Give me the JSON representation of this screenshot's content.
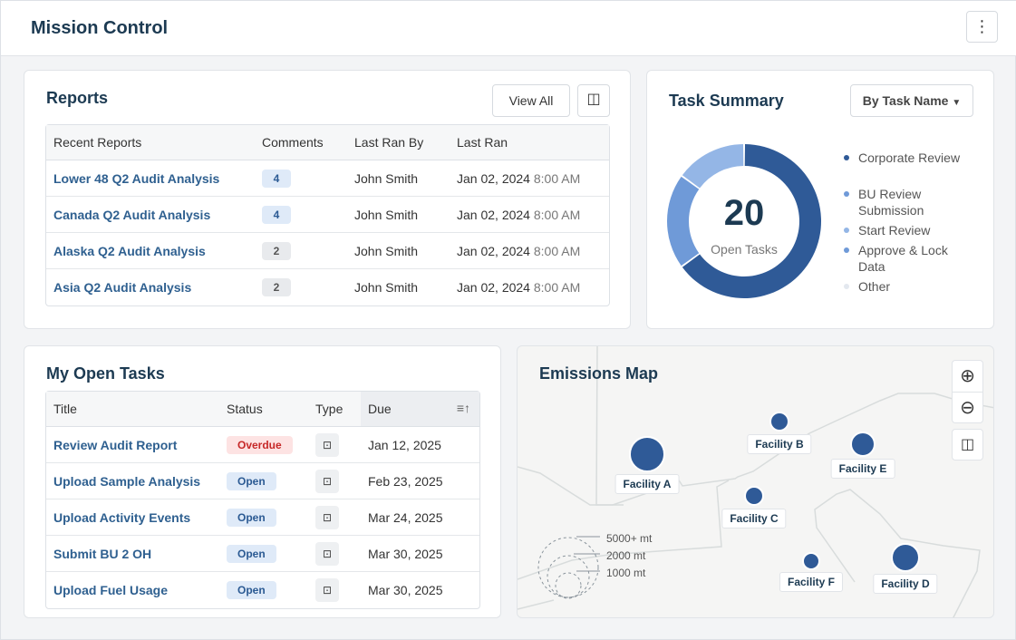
{
  "header": {
    "title": "Mission Control",
    "menu_icon": "more-vertical-icon"
  },
  "reports": {
    "title": "Reports",
    "view_all": "View All",
    "columns": [
      "Recent Reports",
      "Comments",
      "Last Ran By",
      "Last Ran"
    ],
    "rows": [
      {
        "name": "Lower 48 Q2 Audit Analysis",
        "comments": "4",
        "by": "John Smith",
        "date": "Jan 02, 2024",
        "time": "8:00 AM"
      },
      {
        "name": "Canada Q2 Audit Analysis",
        "comments": "4",
        "by": "John Smith",
        "date": "Jan 02, 2024",
        "time": "8:00 AM"
      },
      {
        "name": "Alaska Q2 Audit Analysis",
        "comments": "2",
        "by": "John Smith",
        "date": "Jan 02, 2024",
        "time": "8:00 AM"
      },
      {
        "name": "Asia Q2 Audit Analysis",
        "comments": "2",
        "by": "John Smith",
        "date": "Jan 02, 2024",
        "time": "8:00 AM"
      }
    ]
  },
  "task_summary": {
    "title": "Task Summary",
    "dropdown": "By Task Name",
    "total": "20",
    "total_label": "Open Tasks",
    "legend": [
      {
        "label": "Corporate Review",
        "color": "#2f5a97",
        "value": 13
      },
      {
        "label": "BU Review Submission",
        "color": "#6f9ad8",
        "value": 4
      },
      {
        "label": "Start Review",
        "color": "#94b6e6",
        "value": 3
      },
      {
        "label": "Approve & Lock Data",
        "color": "#6f9ad8",
        "value": 0
      },
      {
        "label": "Other",
        "color": "#e3e8ef",
        "value": 0
      }
    ]
  },
  "tasks": {
    "title": "My Open Tasks",
    "columns": [
      "Title",
      "Status",
      "Type",
      "Due"
    ],
    "rows": [
      {
        "title": "Review Audit Report",
        "status": "Overdue",
        "due": "Jan 12, 2025"
      },
      {
        "title": "Upload Sample Analysis",
        "status": "Open",
        "due": "Feb 23, 2025"
      },
      {
        "title": "Upload Activity Events",
        "status": "Open",
        "due": "Mar 24, 2025"
      },
      {
        "title": "Submit BU 2 OH",
        "status": "Open",
        "due": "Mar 30, 2025"
      },
      {
        "title": "Upload Fuel Usage",
        "status": "Open",
        "due": "Mar 30, 2025"
      }
    ]
  },
  "map": {
    "title": "Emissions Map",
    "scale": [
      "5000+ mt",
      "2000 mt",
      "1000 mt"
    ],
    "facilities": [
      "Facility A",
      "Facility B",
      "Facility C",
      "Facility D",
      "Facility E",
      "Facility F"
    ]
  }
}
